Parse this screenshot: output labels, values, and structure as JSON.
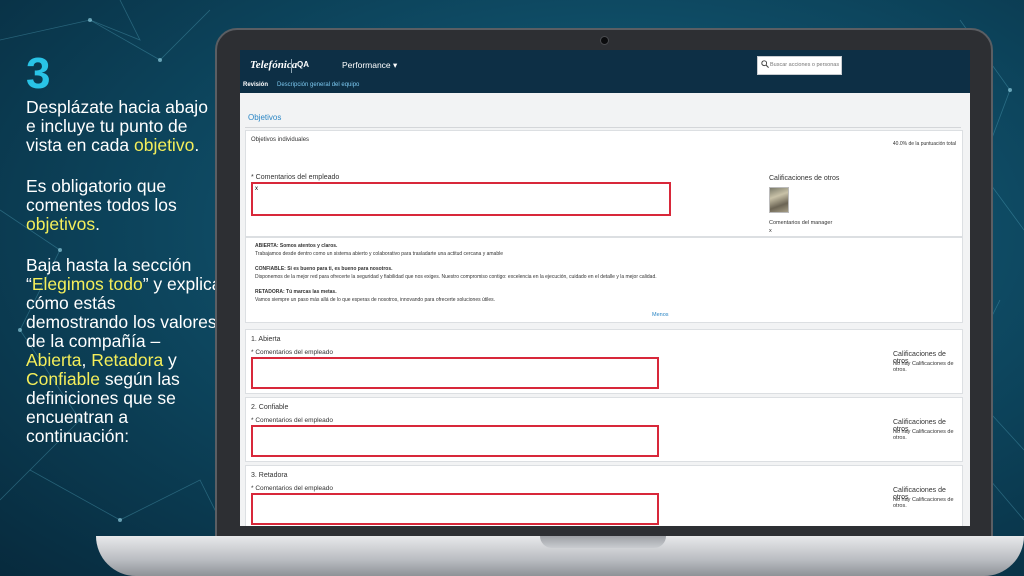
{
  "slide": {
    "step_number": "3",
    "p1": {
      "part1": "Desplázate hacia abajo e incluye tu punto de vista en cada ",
      "highlight": "objetivo",
      "end": "."
    },
    "p2": {
      "part1": "Es obligatorio que comentes todos los ",
      "highlight": "objetivos",
      "end": "."
    },
    "p3": {
      "part1": "Baja hasta la sección “",
      "h1": "Elegimos todo",
      "part2": "” y explica cómo estás demostrando los valores de la compañía – ",
      "h2": "Abierta",
      "sep1": ", ",
      "h3": "Retadora",
      "sep2": " y ",
      "h4": "Confiable",
      "part3": " según las definiciones que se encuentran a continuación:"
    },
    "colors": {
      "highlight": "#f4ee5a",
      "step": "#29c3e6"
    }
  },
  "app": {
    "logo": "Telefónica",
    "env": "QA",
    "menu": "Performance ▾",
    "search_placeholder": "Buscar acciones o personas",
    "subnav": {
      "review": "Revisión",
      "team": "Descripción general del equipo"
    }
  },
  "objectives": {
    "section_title": "Objetivos",
    "individual": {
      "label": "Objetivos individuales",
      "score": "40.0% de la puntuación total",
      "comment_label": "* Comentarios del empleado",
      "comment_value": "x",
      "others_label": "Calificaciones de otros",
      "manager_label": "Comentarios del manager",
      "manager_value": "x"
    }
  },
  "values": {
    "abierta_title": "ABIERTA: Somos atentos y claros.",
    "abierta_desc": "Trabajamos desde dentro como un sistema abierto y colaborativo para trasladarte una actitud cercana y amable",
    "confiable_title": "CONFIABLE: Si es bueno para ti, es bueno para nosotros.",
    "confiable_desc": "Disponemos de la mejor red para ofrecerte la seguridad y fiabilidad que nos exiges. Nuestro compromiso contigo: excelencia en la ejecución, cuidado en el detalle y la mejor calidad.",
    "retadora_title": "RETADORA: Tú marcas las metas.",
    "retadora_desc": "Vamos siempre un paso más allá de lo que esperas de nosotros, innovando para ofrecerte soluciones útiles.",
    "less_link": "Menos"
  },
  "value_items": [
    {
      "title": "1. Abierta",
      "comment_label": "* Comentarios del empleado",
      "others_label": "Calificaciones de otros",
      "none_text": "No hay Calificaciones de otros."
    },
    {
      "title": "2. Confiable",
      "comment_label": "* Comentarios del empleado",
      "others_label": "Calificaciones de otros",
      "none_text": "No hay Calificaciones de otros."
    },
    {
      "title": "3. Retadora",
      "comment_label": "* Comentarios del empleado",
      "others_label": "Calificaciones de otros",
      "none_text": "No hay Calificaciones de otros."
    }
  ],
  "icons": {
    "search": "search-icon",
    "avatar": "avatar-image"
  }
}
